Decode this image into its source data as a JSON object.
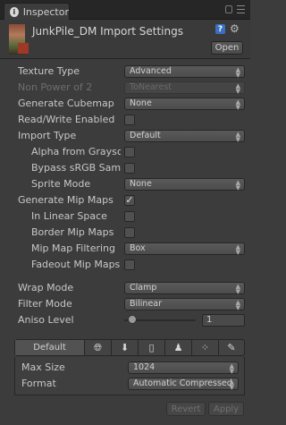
{
  "tab": {
    "title": "Inspector"
  },
  "header": {
    "title": "JunkPile_DM Import Settings",
    "open_label": "Open"
  },
  "fields": {
    "texture_type": {
      "label": "Texture Type",
      "value": "Advanced"
    },
    "non_power_of_2": {
      "label": "Non Power of 2",
      "value": "ToNearest"
    },
    "generate_cubemap": {
      "label": "Generate Cubemap",
      "value": "None"
    },
    "read_write_enabled": {
      "label": "Read/Write Enabled",
      "checked": false
    },
    "import_type": {
      "label": "Import Type",
      "value": "Default"
    },
    "alpha_from_grayscale": {
      "label": "Alpha from Grayscale",
      "checked": false
    },
    "bypass_srgb": {
      "label": "Bypass sRGB Sampling",
      "checked": false
    },
    "sprite_mode": {
      "label": "Sprite Mode",
      "value": "None"
    },
    "generate_mip_maps": {
      "label": "Generate Mip Maps",
      "checked": true
    },
    "in_linear_space": {
      "label": "In Linear Space",
      "checked": false
    },
    "border_mip_maps": {
      "label": "Border Mip Maps",
      "checked": false
    },
    "mip_map_filtering": {
      "label": "Mip Map Filtering",
      "value": "Box"
    },
    "fadeout_mip_maps": {
      "label": "Fadeout Mip Maps",
      "checked": false
    },
    "wrap_mode": {
      "label": "Wrap Mode",
      "value": "Clamp"
    },
    "filter_mode": {
      "label": "Filter Mode",
      "value": "Bilinear"
    },
    "aniso_level": {
      "label": "Aniso Level",
      "value": "1"
    }
  },
  "platform_tabs": {
    "default_label": "Default",
    "icons": [
      "globe-icon",
      "download-icon",
      "phone-icon",
      "android-icon",
      "blackberry-icon",
      "brush-icon"
    ]
  },
  "platform": {
    "max_size": {
      "label": "Max Size",
      "value": "1024"
    },
    "format": {
      "label": "Format",
      "value": "Automatic Compressed"
    }
  },
  "buttons": {
    "revert": "Revert",
    "apply": "Apply"
  }
}
